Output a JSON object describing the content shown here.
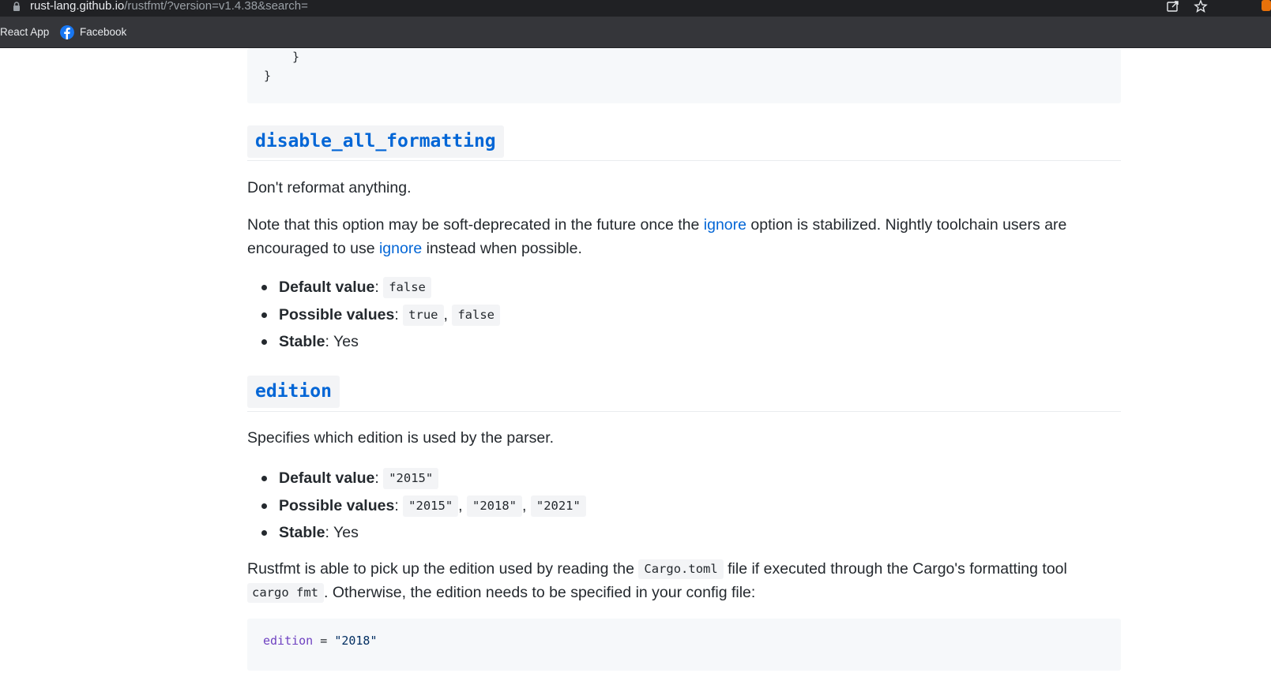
{
  "browser": {
    "url_host": "rust-lang.github.io",
    "url_rest": "/rustfmt/?version=v1.4.38&search=",
    "bookmarks": [
      {
        "label": "React App"
      },
      {
        "label": "Facebook",
        "icon": "facebook-icon"
      }
    ],
    "icons": [
      "lock-icon",
      "share-icon",
      "star-icon",
      "extension-icon"
    ]
  },
  "top_code": {
    "line1": "}",
    "line2": "}"
  },
  "sections": {
    "disable_all_formatting": {
      "title": "disable_all_formatting",
      "desc": "Don't reformat anything.",
      "note_part1": "Note that this option may be soft-deprecated in the future once the ",
      "note_link1": "ignore",
      "note_part2": " option is stabilized. Nightly toolchain users are encouraged to use ",
      "note_link2": "ignore",
      "note_part3": " instead when possible.",
      "default_label": "Default value",
      "default_value": "false",
      "possible_label": "Possible values",
      "possible_values": [
        "true",
        "false"
      ],
      "stable_label": "Stable",
      "stable_value": "Yes"
    },
    "edition": {
      "title": "edition",
      "desc": "Specifies which edition is used by the parser.",
      "default_label": "Default value",
      "default_value": "\"2015\"",
      "possible_label": "Possible values",
      "possible_values": [
        "\"2015\"",
        "\"2018\"",
        "\"2021\""
      ],
      "stable_label": "Stable",
      "stable_value": "Yes",
      "rust_part1": "Rustfmt is able to pick up the edition used by reading the ",
      "rust_code1": "Cargo.toml",
      "rust_part2": " file if executed through the Cargo's formatting tool ",
      "rust_code2": "cargo fmt",
      "rust_part3": ". Otherwise, the edition needs to be specified in your config file:",
      "config_key": "edition",
      "config_eq": " = ",
      "config_val": "\"2018\""
    }
  },
  "colors": {
    "link": "#0366d6",
    "code_bg": "#f6f8fa",
    "text": "#24292e",
    "chrome_bg": "#202124",
    "bookmark_bar_bg": "#35363a"
  }
}
